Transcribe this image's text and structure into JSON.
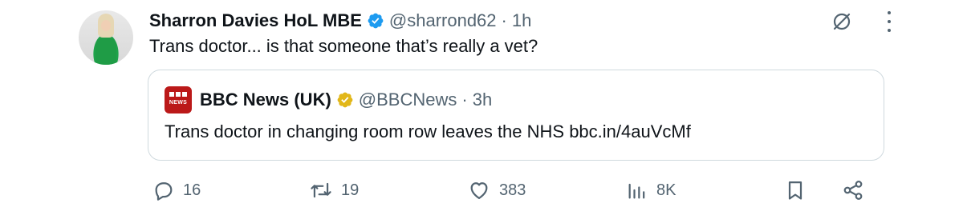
{
  "tweet": {
    "author_name": "Sharron Davies HoL MBE",
    "handle": "@sharrond62",
    "separator": "·",
    "time": "1h",
    "text": "Trans doctor... is that someone that’s really a vet?"
  },
  "quote": {
    "author_name": "BBC News (UK)",
    "handle": "@BBCNews",
    "separator": "·",
    "time": "3h",
    "text": "Trans doctor in changing room row leaves the NHS bbc.in/4auVcMf",
    "logo_text": "NEWS"
  },
  "actions": {
    "replies": "16",
    "reposts": "19",
    "likes": "383",
    "views": "8K"
  },
  "colors": {
    "verified_blue": "#1d9bf0",
    "verified_gold": "#e2b719",
    "bbc_red": "#bb1919",
    "muted": "#536471"
  },
  "icons": [
    "verified-badge-icon",
    "grok-icon",
    "more-icon",
    "reply-icon",
    "repost-icon",
    "like-icon",
    "views-icon",
    "bookmark-icon",
    "share-icon"
  ]
}
